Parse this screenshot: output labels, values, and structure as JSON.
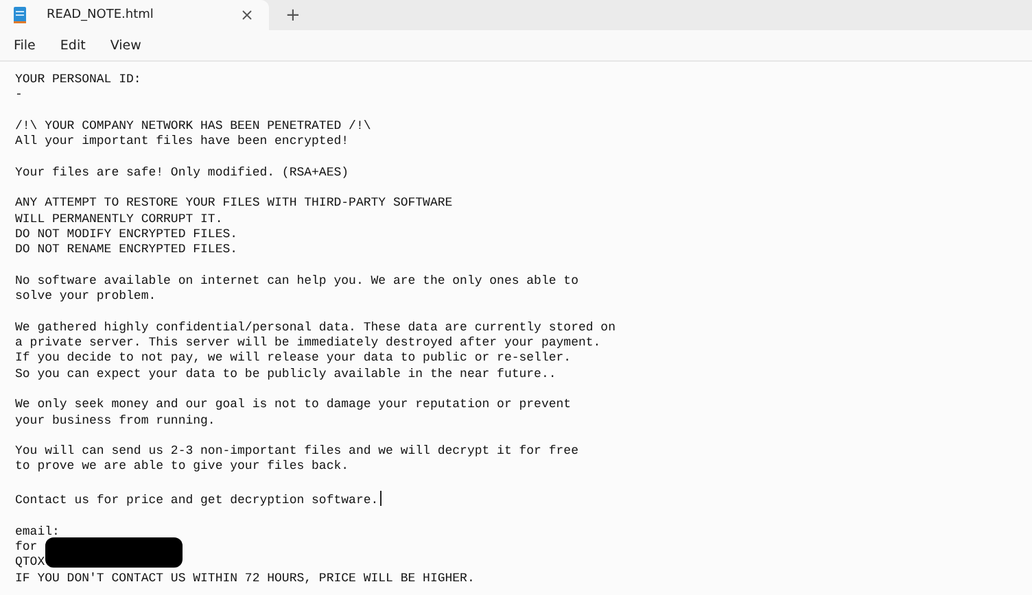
{
  "tabs": [
    {
      "title": "READ_NOTE.html",
      "selected": true
    }
  ],
  "new_tab": "+",
  "menu": [
    "File",
    "Edit",
    "View"
  ],
  "document": {
    "paragraphs": [
      {
        "lines": [
          "YOUR PERSONAL ID:",
          "-"
        ],
        "caret_at_end": false,
        "redacted": false
      },
      {
        "lines": [
          "/!\\ YOUR COMPANY NETWORK HAS BEEN PENETRATED /!\\",
          "All your important files have been encrypted!"
        ],
        "caret_at_end": false,
        "redacted": false
      },
      {
        "lines": [
          "Your files are safe! Only modified. (RSA+AES)"
        ],
        "caret_at_end": false,
        "redacted": false
      },
      {
        "lines": [
          "ANY ATTEMPT TO RESTORE YOUR FILES WITH THIRD-PARTY SOFTWARE",
          "WILL PERMANENTLY CORRUPT IT.",
          "DO NOT MODIFY ENCRYPTED FILES.",
          "DO NOT RENAME ENCRYPTED FILES."
        ],
        "caret_at_end": false,
        "redacted": false
      },
      {
        "lines": [
          "No software available on internet can help you. We are the only ones able to",
          "solve your problem."
        ],
        "caret_at_end": false,
        "redacted": false
      },
      {
        "lines": [
          "We gathered highly confidential/personal data. These data are currently stored on",
          "a private server. This server will be immediately destroyed after your payment.",
          "If you decide to not pay, we will release your data to public or re-seller.",
          "So you can expect your data to be publicly available in the near future.."
        ],
        "caret_at_end": false,
        "redacted": false
      },
      {
        "lines": [
          "We only seek money and our goal is not to damage your reputation or prevent",
          "your business from running."
        ],
        "caret_at_end": false,
        "redacted": false
      },
      {
        "lines": [
          "You will can send us 2-3 non-important files and we will decrypt it for free",
          "to prove we are able to give your files back."
        ],
        "caret_at_end": false,
        "redacted": false
      },
      {
        "lines": [
          "Contact us for price and get decryption software."
        ],
        "caret_at_end": true,
        "redacted": false
      },
      {
        "lines": [
          "email:",
          "for",
          "QTOX",
          "IF YOU DON'T CONTACT US WITHIN 72 HOURS, PRICE WILL BE HIGHER."
        ],
        "caret_at_end": false,
        "redacted": true
      }
    ]
  }
}
